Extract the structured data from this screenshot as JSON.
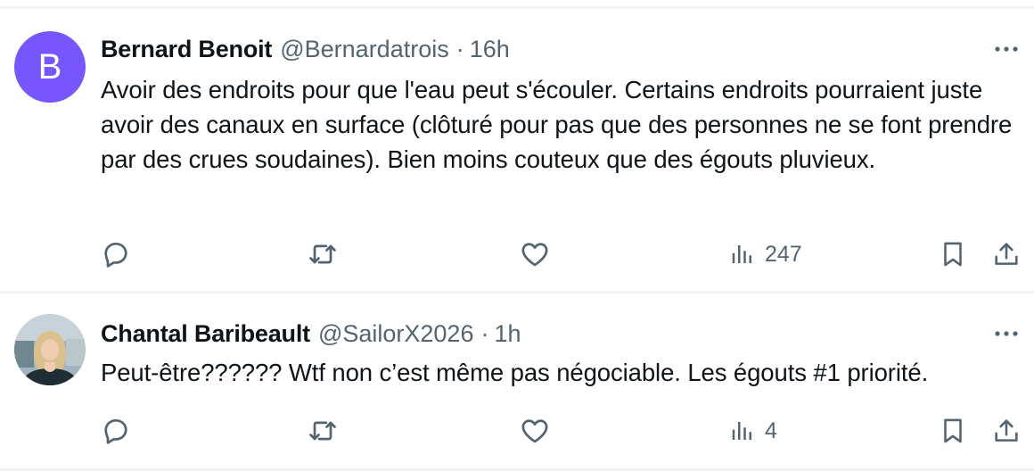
{
  "tweets": [
    {
      "author_name": "Bernard Benoit",
      "handle": "@Bernardatrois",
      "separator": "·",
      "time": "16h",
      "avatar_letter": "B",
      "avatar_color": "#7856ff",
      "text": "Avoir des endroits pour que l'eau peut s'écouler. Certains endroits pourraient juste avoir des canaux en surface (clôturé pour pas que des personnes ne se font prendre par des crues soudaines). Bien moins couteux que des égouts pluvieux.",
      "views": "247"
    },
    {
      "author_name": "Chantal Baribeault",
      "handle": "@SailorX2026",
      "separator": "·",
      "time": "1h",
      "avatar_type": "photo",
      "text": "Peut-être?????? Wtf non c’est même pas négociable. Les égouts #1 priorité.",
      "views": "4"
    }
  ],
  "icons": {
    "more": "more-horizontal-icon",
    "reply": "reply-icon",
    "retweet": "retweet-icon",
    "like": "heart-icon",
    "views": "views-chart-icon",
    "bookmark": "bookmark-icon",
    "share": "share-icon"
  },
  "colors": {
    "text_primary": "#0f1419",
    "text_secondary": "#536471",
    "divider": "#eff3f4"
  }
}
